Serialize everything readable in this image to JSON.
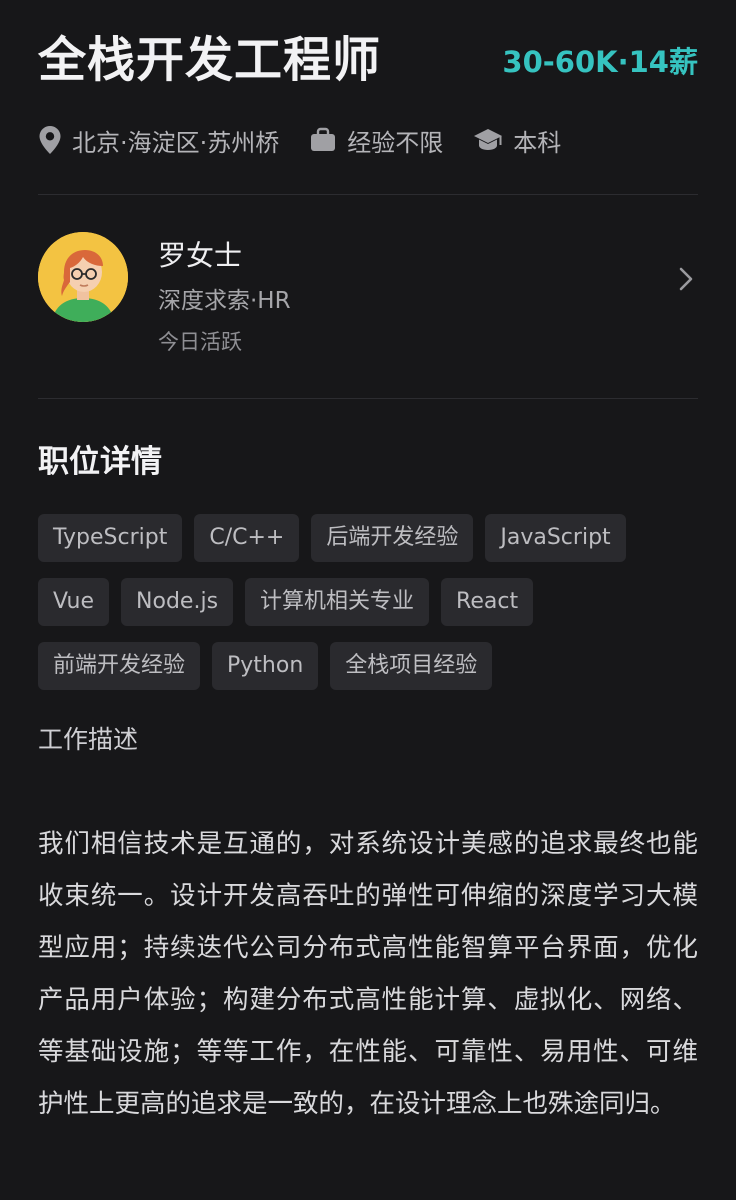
{
  "job": {
    "title": "全栈开发工程师",
    "salary": "30-60K·14薪",
    "location": "北京·海淀区·苏州桥",
    "experience": "经验不限",
    "education": "本科"
  },
  "recruiter": {
    "name": "罗女士",
    "title": "深度求索·HR",
    "active_status": "今日活跃"
  },
  "details": {
    "section_title": "职位详情",
    "tags": [
      "TypeScript",
      "C/C++",
      "后端开发经验",
      "JavaScript",
      "Vue",
      "Node.js",
      "计算机相关专业",
      "React",
      "前端开发经验",
      "Python",
      "全栈项目经验"
    ],
    "description_label": "工作描述",
    "description": "我们相信技术是互通的，对系统设计美感的追求最终也能收束统一。设计开发高吞吐的弹性可伸缩的深度学习大模型应用；持续迭代公司分布式高性能智算平台界面，优化产品用户体验；构建分布式高性能计算、虚拟化、网络、等基础设施；等等工作，在性能、可靠性、易用性、可维护性上更高的追求是一致的，在设计理念上也殊途同归。"
  },
  "icons": {
    "location": "location-pin-icon",
    "experience": "briefcase-icon",
    "education": "graduation-cap-icon",
    "chevron": "chevron-right-icon"
  },
  "colors": {
    "background": "#171719",
    "salary": "#36c3c0",
    "tag_background": "#2a2a2e"
  }
}
